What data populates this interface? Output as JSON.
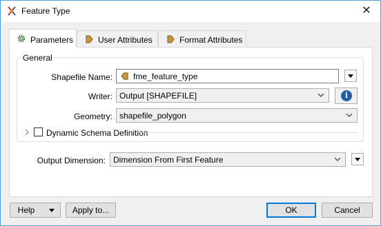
{
  "window": {
    "title": "Feature Type",
    "close_glyph": "✕"
  },
  "tabs": [
    {
      "label": "Parameters",
      "icon": "gear-icon",
      "active": true
    },
    {
      "label": "User Attributes",
      "icon": "attribute-arrow-icon",
      "active": false
    },
    {
      "label": "Format Attributes",
      "icon": "attribute-arrow-icon",
      "active": false
    }
  ],
  "general": {
    "title": "General",
    "shapefile_name": {
      "label": "Shapefile Name:",
      "value": "fme_feature_type"
    },
    "writer": {
      "label": "Writer:",
      "value": "Output [SHAPEFILE]",
      "info_glyph": "i"
    },
    "geometry": {
      "label": "Geometry:",
      "value": "shapefile_polygon"
    },
    "dynamic_schema": {
      "label": "Dynamic Schema Definition",
      "checked": false
    }
  },
  "output_dimension": {
    "label": "Output Dimension:",
    "value": "Dimension From First Feature"
  },
  "buttons": {
    "help": "Help",
    "apply_to": "Apply to...",
    "ok": "OK",
    "cancel": "Cancel"
  },
  "colors": {
    "accent": "#0078d7",
    "info": "#1f5fa8",
    "attribute_icon": "#c8963e"
  }
}
